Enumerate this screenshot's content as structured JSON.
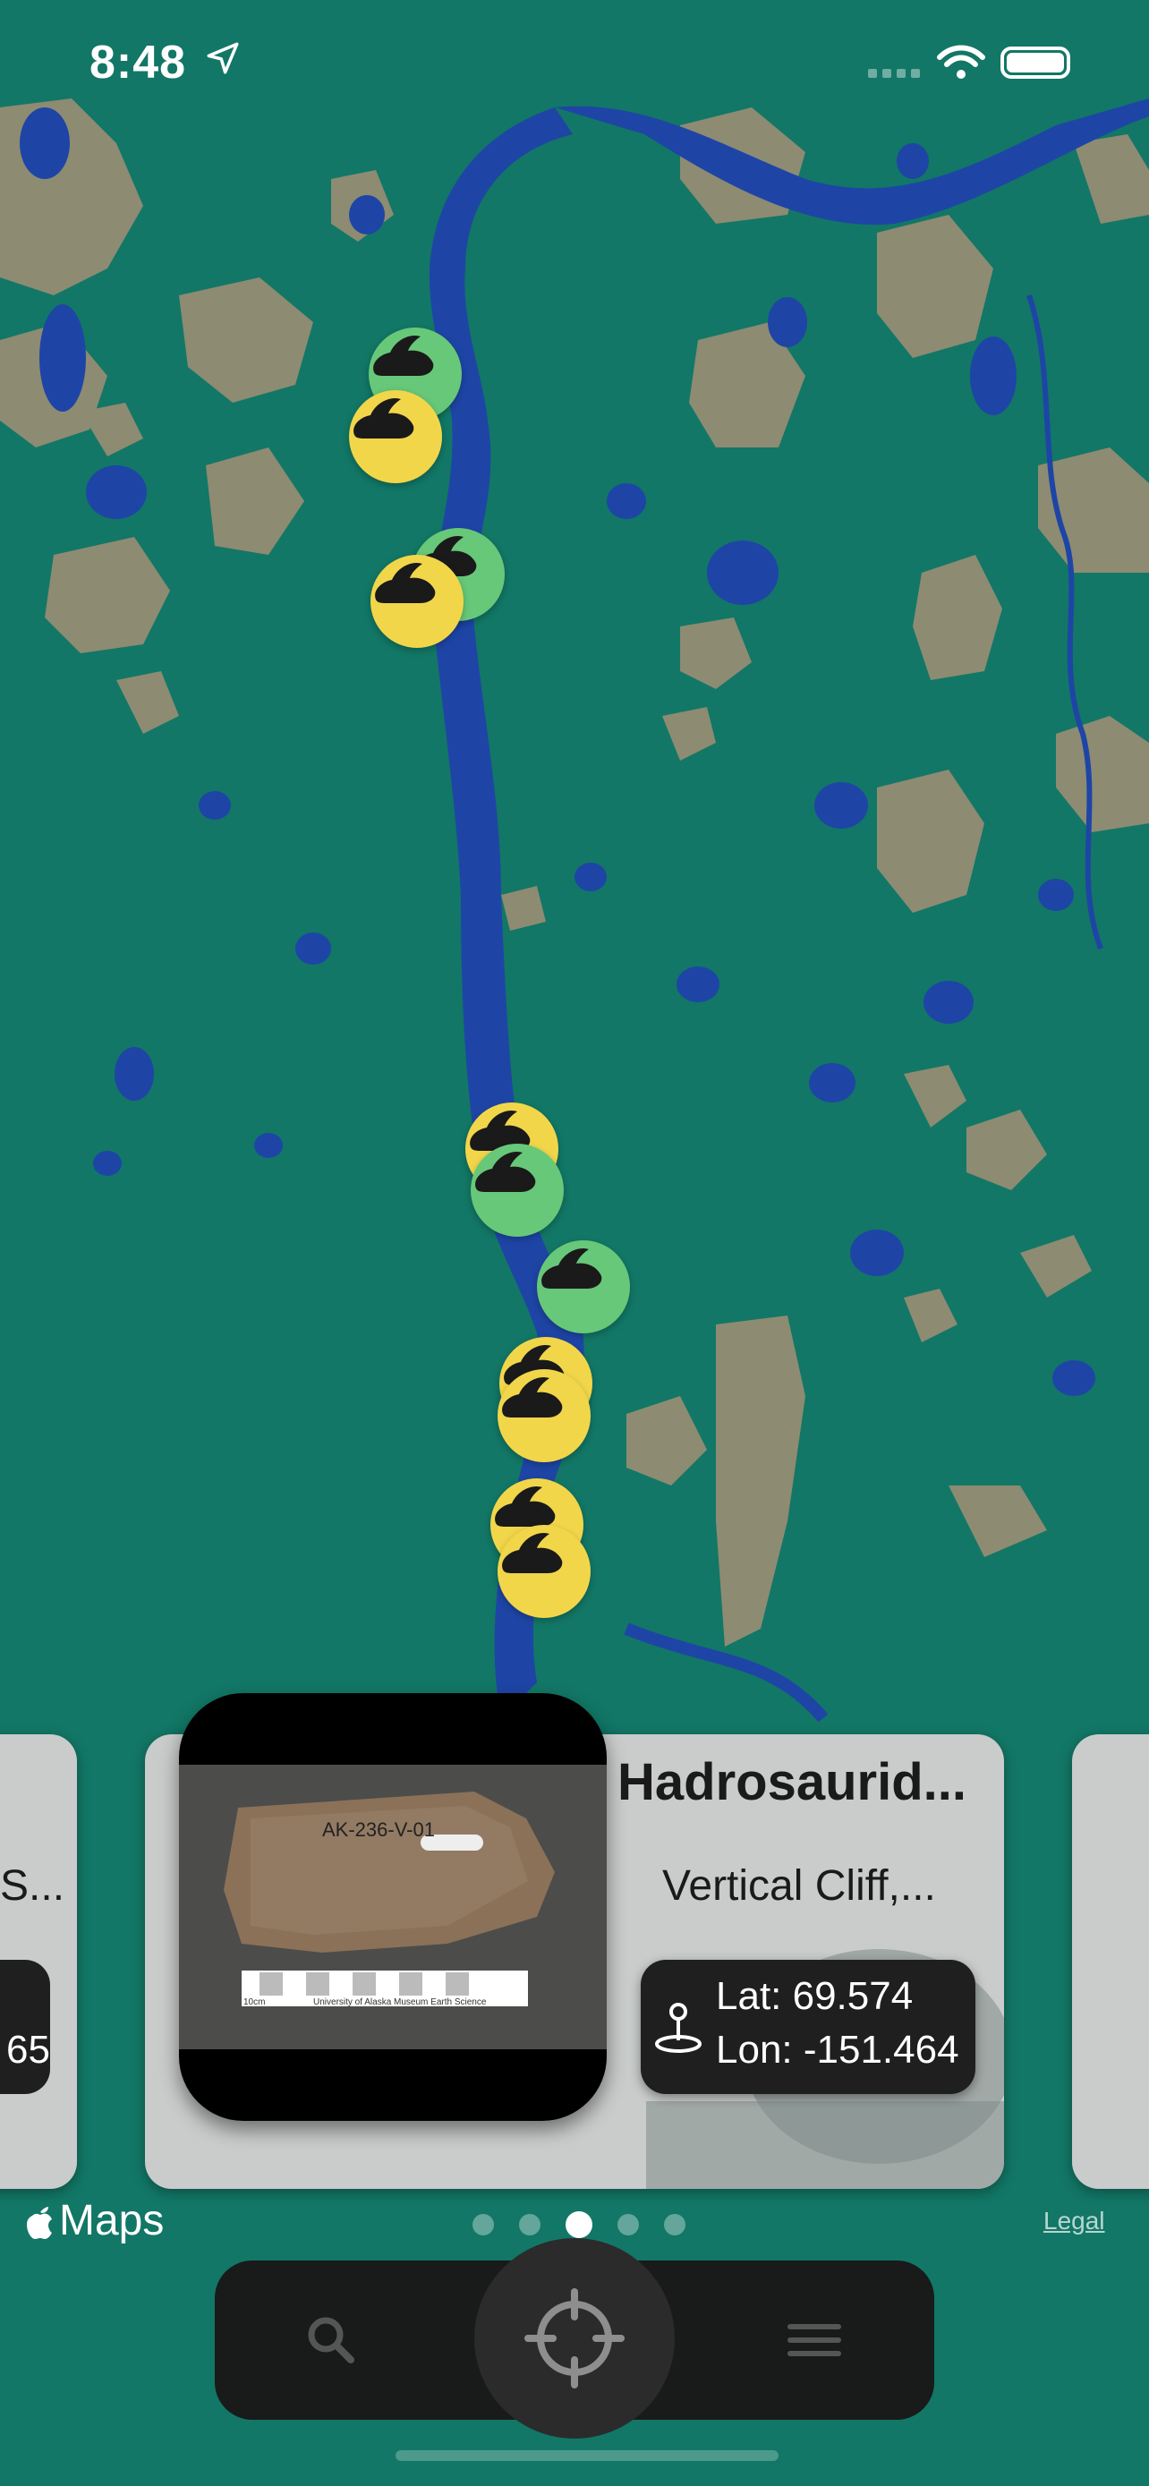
{
  "status_bar": {
    "time": "8:48"
  },
  "map": {
    "colors": {
      "water_green": "#127766",
      "river": "#1e45a6",
      "land": "#8d8b72"
    },
    "markers": [
      {
        "color": "green",
        "icon": "rabbit-icon"
      },
      {
        "color": "yellow",
        "icon": "rabbit-icon"
      },
      {
        "color": "green",
        "icon": "rabbit-icon"
      },
      {
        "color": "yellow",
        "icon": "rabbit-icon"
      },
      {
        "color": "yellow",
        "icon": "rabbit-icon"
      },
      {
        "color": "green",
        "icon": "rabbit-icon"
      },
      {
        "color": "green",
        "icon": "rabbit-icon"
      },
      {
        "color": "yellow",
        "icon": "rabbit-icon"
      },
      {
        "color": "yellow",
        "icon": "rabbit-icon"
      },
      {
        "color": "yellow",
        "icon": "rabbit-icon"
      },
      {
        "color": "yellow",
        "icon": "rabbit-icon"
      }
    ]
  },
  "cards": {
    "left": {
      "title": "S...",
      "lon": "65"
    },
    "main": {
      "title": "Hadrosaurid...",
      "subtitle": "Vertical Cliff,...",
      "lat": "Lat: 69.574",
      "lon": "Lon: -151.464",
      "photo_label": "AK-236-V-01",
      "photo_scale_left": "10cm",
      "photo_scale_caption": "University of Alaska Museum Earth Science"
    }
  },
  "maps_attribution": "Maps",
  "legal": "Legal",
  "pager": {
    "count": 5,
    "active": 3
  },
  "toolbar": {
    "buttons": [
      "search-icon",
      "locate-icon",
      "menu-icon"
    ]
  }
}
